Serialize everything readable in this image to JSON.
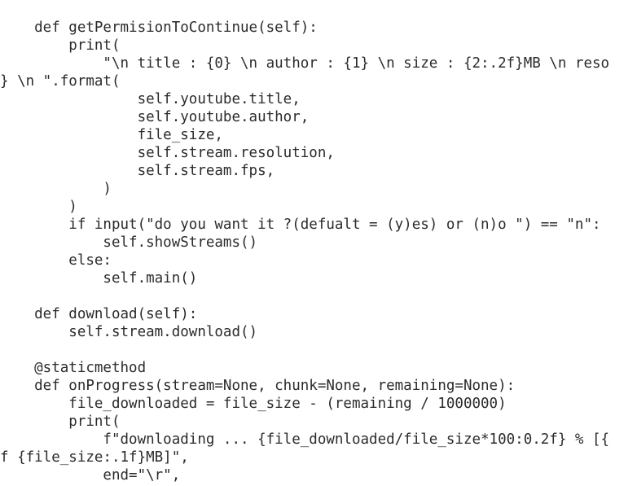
{
  "editor": {
    "background": "#ffffff",
    "text_color": "#2b2b2b",
    "lines": [
      "    def getPermisionToContinue(self):",
      "        print(",
      "            \"\\n title : {0} \\n author : {1} \\n size : {2:.2f}MB \\n reso",
      "} \\n \".format(",
      "                self.youtube.title,",
      "                self.youtube.author,",
      "                file_size,",
      "                self.stream.resolution,",
      "                self.stream.fps,",
      "            )",
      "        )",
      "        if input(\"do you want it ?(defualt = (y)es) or (n)o \") == \"n\":",
      "            self.showStreams()",
      "        else:",
      "            self.main()",
      "",
      "    def download(self):",
      "        self.stream.download()",
      "",
      "    @staticmethod",
      "    def onProgress(stream=None, chunk=None, remaining=None):",
      "        file_downloaded = file_size - (remaining / 1000000)",
      "        print(",
      "            f\"downloading ... {file_downloaded/file_size*100:0.2f} % [{",
      "f {file_size:.1f}MB]\",",
      "            end=\"\\r\","
    ]
  }
}
